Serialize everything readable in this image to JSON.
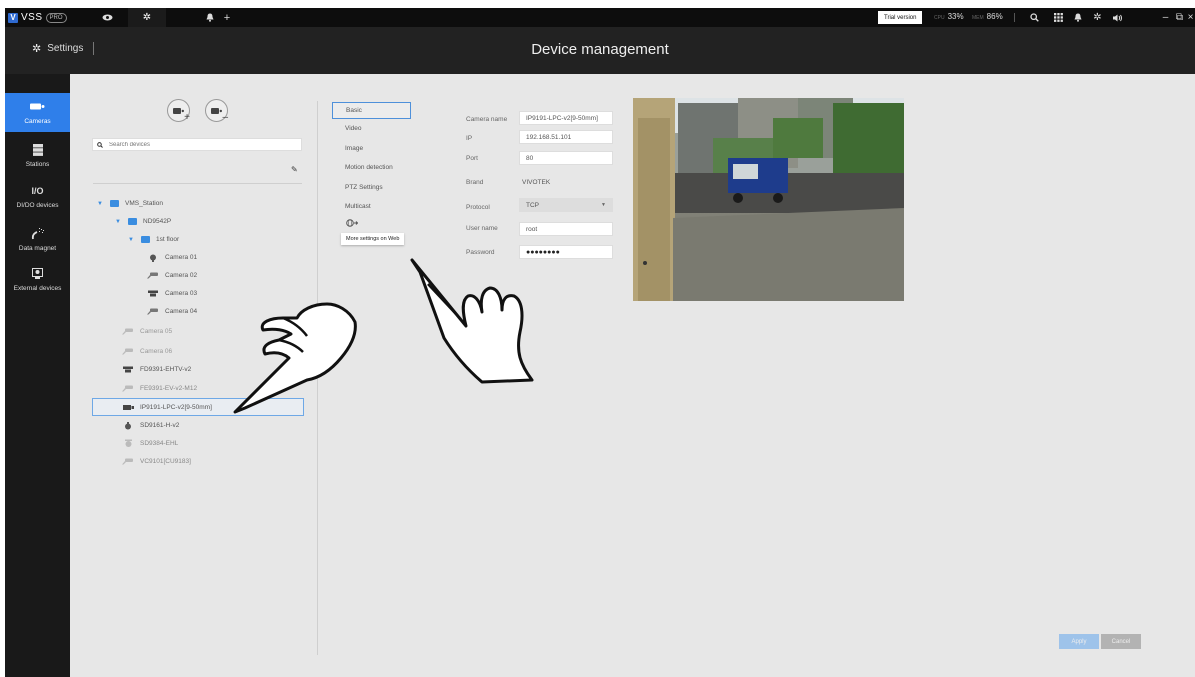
{
  "app": {
    "brand": "VSS",
    "edition": "PRO",
    "trial_label": "Trial version",
    "cpu_label": "CPU",
    "cpu_value": "33%",
    "mem_label": "MEM",
    "mem_value": "86%"
  },
  "header": {
    "settings_label": "Settings",
    "title": "Device management"
  },
  "nav": [
    {
      "label": "Cameras",
      "icon": "camera-icon"
    },
    {
      "label": "Stations",
      "icon": "station-icon"
    },
    {
      "label": "DI/DO devices",
      "icon_text": "I/O"
    },
    {
      "label": "Data magnet",
      "icon": "data-magnet-icon"
    },
    {
      "label": "External devices",
      "icon": "external-device-icon"
    }
  ],
  "search": {
    "placeholder": "Search devices"
  },
  "tree": {
    "station": "VMS_Station",
    "nvr": "ND9542P",
    "floor": "1st floor",
    "cam1": "Camera 01",
    "cam2": "Camera 02",
    "cam3": "Camera 03",
    "cam4": "Camera 04",
    "cam5": "Camera 05",
    "cam6": "Camera 06",
    "dev1": "FD9391-EHTV-v2",
    "dev2": "FE9391-EV-v2-M12",
    "dev3": "IP9191-LPC-v2[9-50mm]",
    "dev4": "SD9161-H-v2",
    "dev5": "SD9384-EHL",
    "dev6": "VC9101[CU9183]"
  },
  "menu": {
    "basic": "Basic",
    "video": "Video",
    "image": "Image",
    "motion": "Motion detection",
    "ptz": "PTZ Settings",
    "multicast": "Multicast",
    "web_tooltip": "More settings on Web"
  },
  "form": {
    "camera_name_label": "Camera name",
    "camera_name": "IP9191-LPC-v2[9-50mm]",
    "ip_label": "IP",
    "ip": "192.168.51.101",
    "port_label": "Port",
    "port": "80",
    "brand_label": "Brand",
    "brand": "VIVOTEK",
    "protocol_label": "Protocol",
    "protocol": "TCP",
    "username_label": "User name",
    "username": "root",
    "password_label": "Password",
    "password": "●●●●●●●●"
  },
  "buttons": {
    "apply": "Apply",
    "cancel": "Cancel"
  },
  "colors": {
    "accent": "#2f7fea",
    "selection_border": "#6ea8e6",
    "topbar": "#0d0d0d"
  }
}
